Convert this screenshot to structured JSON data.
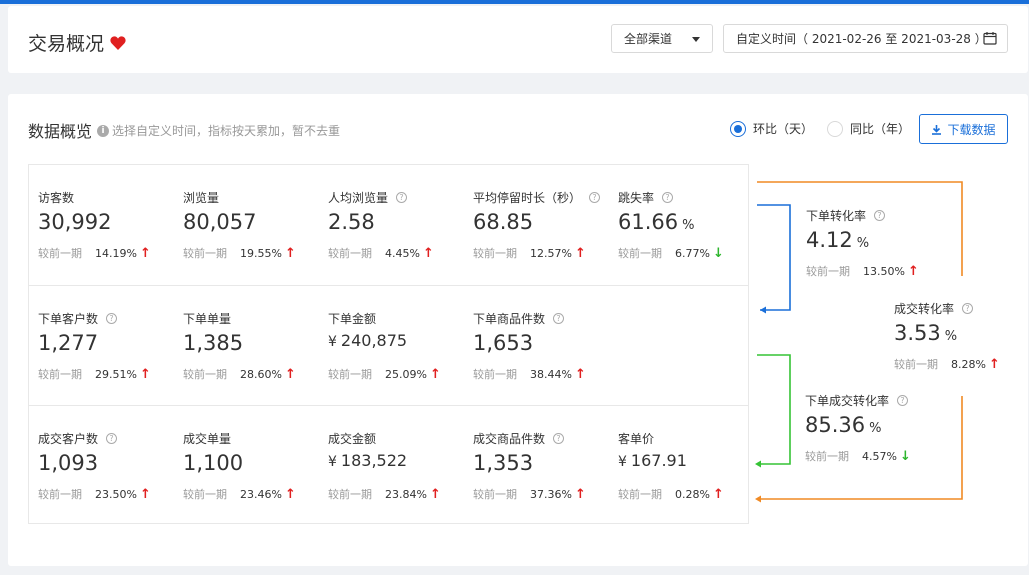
{
  "header": {
    "title": "交易概况",
    "channel": "全部渠道",
    "date_range": "自定义时间（ 2021-02-26 至 2021-03-28 ）"
  },
  "section": {
    "title": "数据概览",
    "hint": "选择自定义时间，指标按天累加，暂不去重",
    "radio_ring": "环比（天）",
    "radio_yoy": "同比（年）",
    "download": "下载数据"
  },
  "compare_label": "较前一期",
  "rows": [
    [
      {
        "label": "访客数",
        "value": "30,992",
        "pct": "14.19%",
        "dir": "↑"
      },
      {
        "label": "浏览量",
        "value": "80,057",
        "pct": "19.55%",
        "dir": "↑"
      },
      {
        "label": "人均浏览量",
        "value": "2.58",
        "pct": "4.45%",
        "dir": "↑"
      },
      {
        "label": "平均停留时长（秒）",
        "value": "68.85",
        "pct": "12.57%",
        "dir": "↑"
      },
      {
        "label": "跳失率",
        "value": "61.66",
        "unit": "%",
        "pct": "6.77%",
        "dir": "↓"
      }
    ],
    [
      {
        "label": "下单客户数",
        "value": "1,277",
        "pct": "29.51%",
        "dir": "↑"
      },
      {
        "label": "下单单量",
        "value": "1,385",
        "pct": "28.60%",
        "dir": "↑"
      },
      {
        "label": "下单金额",
        "currency": "¥",
        "value": "240,875",
        "pct": "25.09%",
        "dir": "↑"
      },
      {
        "label": "下单商品件数",
        "value": "1,653",
        "pct": "38.44%",
        "dir": "↑"
      }
    ],
    [
      {
        "label": "成交客户数",
        "value": "1,093",
        "pct": "23.50%",
        "dir": "↑"
      },
      {
        "label": "成交单量",
        "value": "1,100",
        "pct": "23.46%",
        "dir": "↑"
      },
      {
        "label": "成交金额",
        "currency": "¥",
        "value": "183,522",
        "pct": "23.84%",
        "dir": "↑"
      },
      {
        "label": "成交商品件数",
        "value": "1,353",
        "pct": "37.36%",
        "dir": "↑"
      },
      {
        "label": "客单价",
        "currency": "¥",
        "value": "167.91",
        "pct": "0.28%",
        "dir": "↑"
      }
    ]
  ],
  "conversions": {
    "order_rate": {
      "label": "下单转化率",
      "value": "4.12",
      "unit": "%",
      "pct": "13.50%",
      "dir": "↑"
    },
    "deal_rate": {
      "label": "成交转化率",
      "value": "3.53",
      "unit": "%",
      "pct": "8.28%",
      "dir": "↑"
    },
    "order_deal_rate": {
      "label": "下单成交转化率",
      "value": "85.36",
      "unit": "%",
      "pct": "4.57%",
      "dir": "↓"
    }
  },
  "colors": {
    "accent": "#1a6fd9",
    "up": "#e02020",
    "down": "#2db52d",
    "flow_blue": "#1a6fd9",
    "flow_orange": "#f08a24",
    "flow_green": "#35c335"
  }
}
